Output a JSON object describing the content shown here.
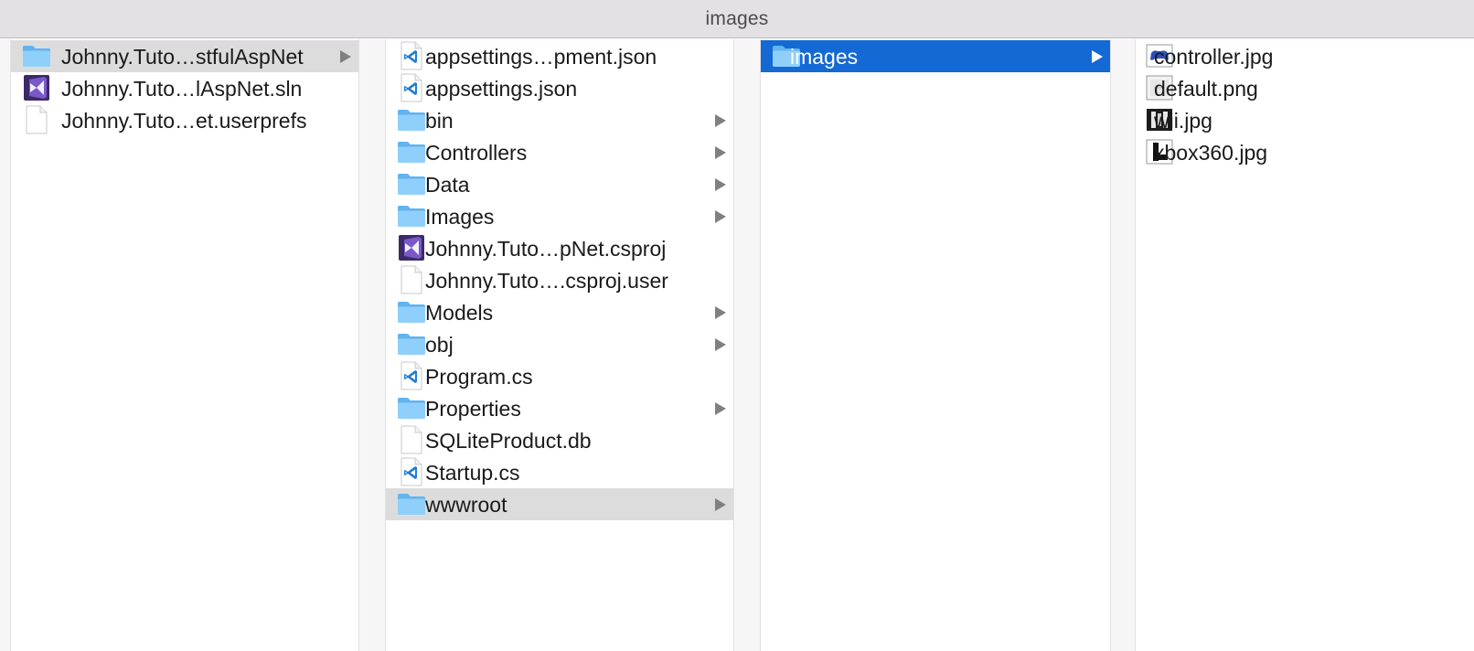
{
  "window": {
    "title": "images"
  },
  "columns": [
    {
      "items": [
        {
          "label": "Johnny.Tuto…stfulAspNet",
          "icon": "folder-icon",
          "folder": true,
          "selected": "gray"
        },
        {
          "label": "Johnny.Tuto…lAspNet.sln",
          "icon": "visual-studio-icon"
        },
        {
          "label": "Johnny.Tuto…et.userprefs",
          "icon": "document-icon"
        }
      ]
    },
    {
      "items": [
        {
          "label": "appsettings…pment.json",
          "icon": "vscode-icon"
        },
        {
          "label": "appsettings.json",
          "icon": "vscode-icon"
        },
        {
          "label": "bin",
          "icon": "folder-icon",
          "folder": true
        },
        {
          "label": "Controllers",
          "icon": "folder-icon",
          "folder": true
        },
        {
          "label": "Data",
          "icon": "folder-icon",
          "folder": true
        },
        {
          "label": "Images",
          "icon": "folder-icon",
          "folder": true
        },
        {
          "label": "Johnny.Tuto…pNet.csproj",
          "icon": "visual-studio-icon"
        },
        {
          "label": "Johnny.Tuto….csproj.user",
          "icon": "document-icon"
        },
        {
          "label": "Models",
          "icon": "folder-icon",
          "folder": true
        },
        {
          "label": "obj",
          "icon": "folder-icon",
          "folder": true
        },
        {
          "label": "Program.cs",
          "icon": "vscode-icon"
        },
        {
          "label": "Properties",
          "icon": "folder-icon",
          "folder": true
        },
        {
          "label": "SQLiteProduct.db",
          "icon": "document-icon"
        },
        {
          "label": "Startup.cs",
          "icon": "vscode-icon"
        },
        {
          "label": "wwwroot",
          "icon": "folder-icon",
          "folder": true,
          "selected": "gray"
        }
      ]
    },
    {
      "items": [
        {
          "label": "images",
          "icon": "folder-icon",
          "folder": true,
          "selected": "blue"
        }
      ]
    },
    {
      "items": [
        {
          "label": "controller.jpg",
          "icon": "controller-thumbnail-icon"
        },
        {
          "label": "default.png",
          "icon": "default-thumbnail-icon"
        },
        {
          "label": "wii.jpg",
          "icon": "wii-thumbnail-icon"
        },
        {
          "label": "xbox360.jpg",
          "icon": "xbox-thumbnail-icon"
        }
      ]
    }
  ],
  "colors": {
    "selection_blue": "#1469d5",
    "selection_gray": "#dcdcdc",
    "folder_blue": "#7cc6f7"
  }
}
